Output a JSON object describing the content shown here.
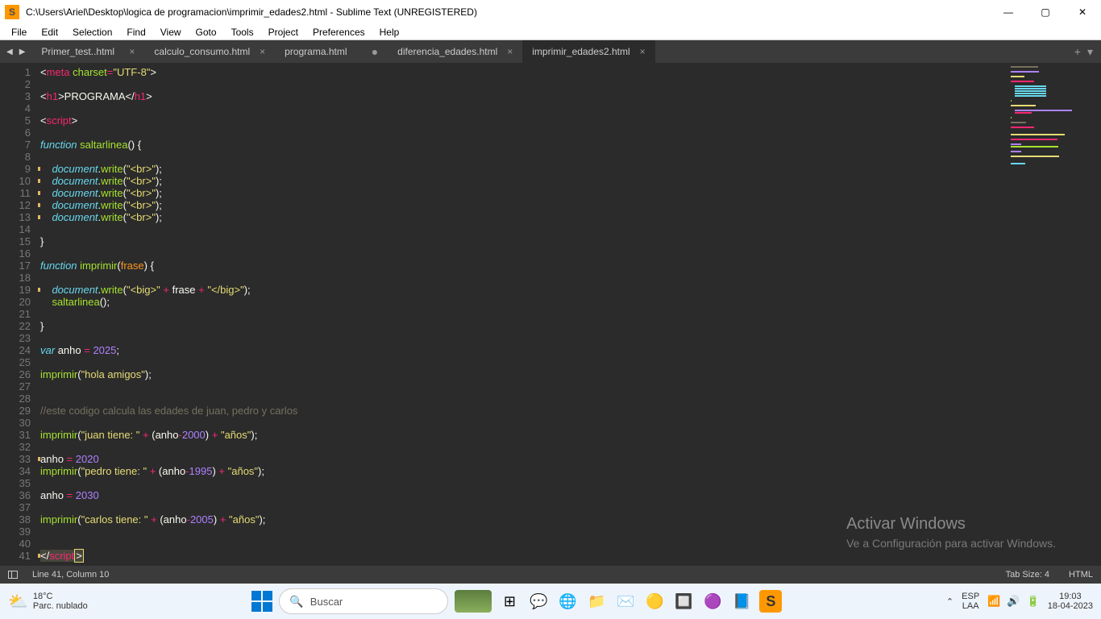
{
  "titlebar": {
    "icon_letter": "S",
    "text": "C:\\Users\\Ariel\\Desktop\\logica de programacion\\imprimir_edades2.html - Sublime Text (UNREGISTERED)",
    "min": "—",
    "max": "▢",
    "close": "✕"
  },
  "menu": [
    "File",
    "Edit",
    "Selection",
    "Find",
    "View",
    "Goto",
    "Tools",
    "Project",
    "Preferences",
    "Help"
  ],
  "tabs": [
    {
      "label": "Primer_test..html",
      "close": "×",
      "modified": false
    },
    {
      "label": "calculo_consumo.html",
      "close": "×",
      "modified": false
    },
    {
      "label": "programa.html",
      "close": "",
      "modified": true
    },
    {
      "label": "diferencia_edades.html",
      "close": "×",
      "modified": false
    },
    {
      "label": "imprimir_edades2.html",
      "close": "×",
      "modified": false,
      "active": true
    }
  ],
  "tabnav": {
    "left": "◀",
    "right": "▶",
    "add": "+",
    "menu": "▾"
  },
  "code": {
    "lines": 41,
    "modified_lines": [
      9,
      10,
      11,
      12,
      13,
      19,
      33,
      41
    ],
    "cursor_line": 41
  },
  "watermark": {
    "title": "Activar Windows",
    "sub": "Ve a Configuración para activar Windows."
  },
  "statusbar": {
    "pos": "Line 41, Column 10",
    "tabsize": "Tab Size: 4",
    "lang": "HTML"
  },
  "taskbar": {
    "temp": "18°C",
    "weather": "Parc. nublado",
    "search": "Buscar",
    "lang1": "ESP",
    "lang2": "LAA",
    "time": "19:03",
    "date": "18-04-2023",
    "chevron": "⌃"
  }
}
